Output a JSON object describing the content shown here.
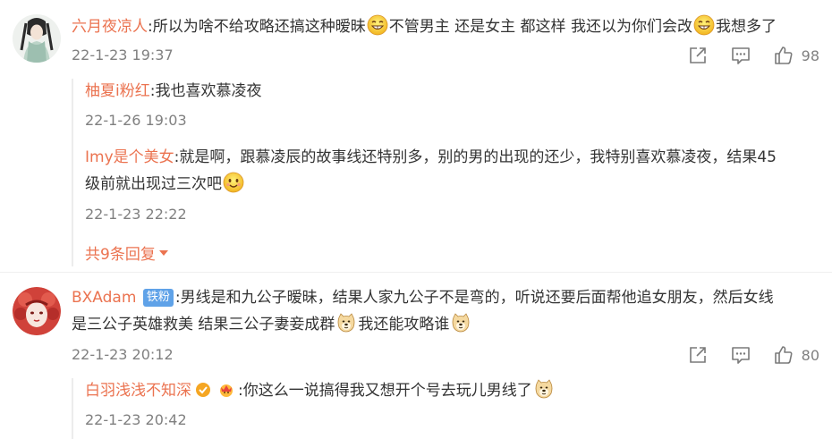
{
  "comments": [
    {
      "username": "六月夜凉人",
      "text_part1": ":所以为啥不给攻略还搞这种暧昧",
      "text_part2": "不管男主 还是女主 都这样 我还以为你们会改",
      "text_part3": "我想多了",
      "time": "22-1-23 19:37",
      "likes": "98",
      "replies": [
        {
          "username": "柚夏i粉红",
          "text": ":我也喜欢慕凌夜",
          "time": "22-1-26 19:03"
        },
        {
          "username": "Imy是个美女",
          "text_line1": ":就是啊，跟慕凌辰的故事线还特别多，别的男的出现的还少，我特别喜欢慕凌夜，结果45",
          "text_line2": "级前就出现过三次吧",
          "time": "22-1-23 22:22"
        }
      ],
      "more_label": "共9条回复"
    },
    {
      "username": "BXAdam",
      "badge": "铁粉",
      "text_line1": ":男线是和九公子暧昧，结果人家九公子不是弯的，听说还要后面帮他追女朋友，然后女线",
      "text_line2a": "是三公子英雄救美 结果三公子妻妾成群",
      "text_line2b": "我还能攻略谁",
      "time": "22-1-23 20:12",
      "likes": "80",
      "replies": [
        {
          "username": "白羽浅浅不知深",
          "text": ":你这么一说搞得我又想开个号去玩儿男线了",
          "time": "22-1-23 20:42"
        }
      ]
    }
  ],
  "icons": {
    "share": "share-icon",
    "comment": "comment-icon",
    "like": "thumbs-up-icon",
    "emoji_smile_tongue": "emoji-grin-icon",
    "emoji_smile": "emoji-smile-icon",
    "emoji_doge": "emoji-doge-icon"
  },
  "colors": {
    "username": "#eb7350",
    "text": "#333333",
    "meta": "#808080",
    "badge": "#5fa2e8"
  }
}
